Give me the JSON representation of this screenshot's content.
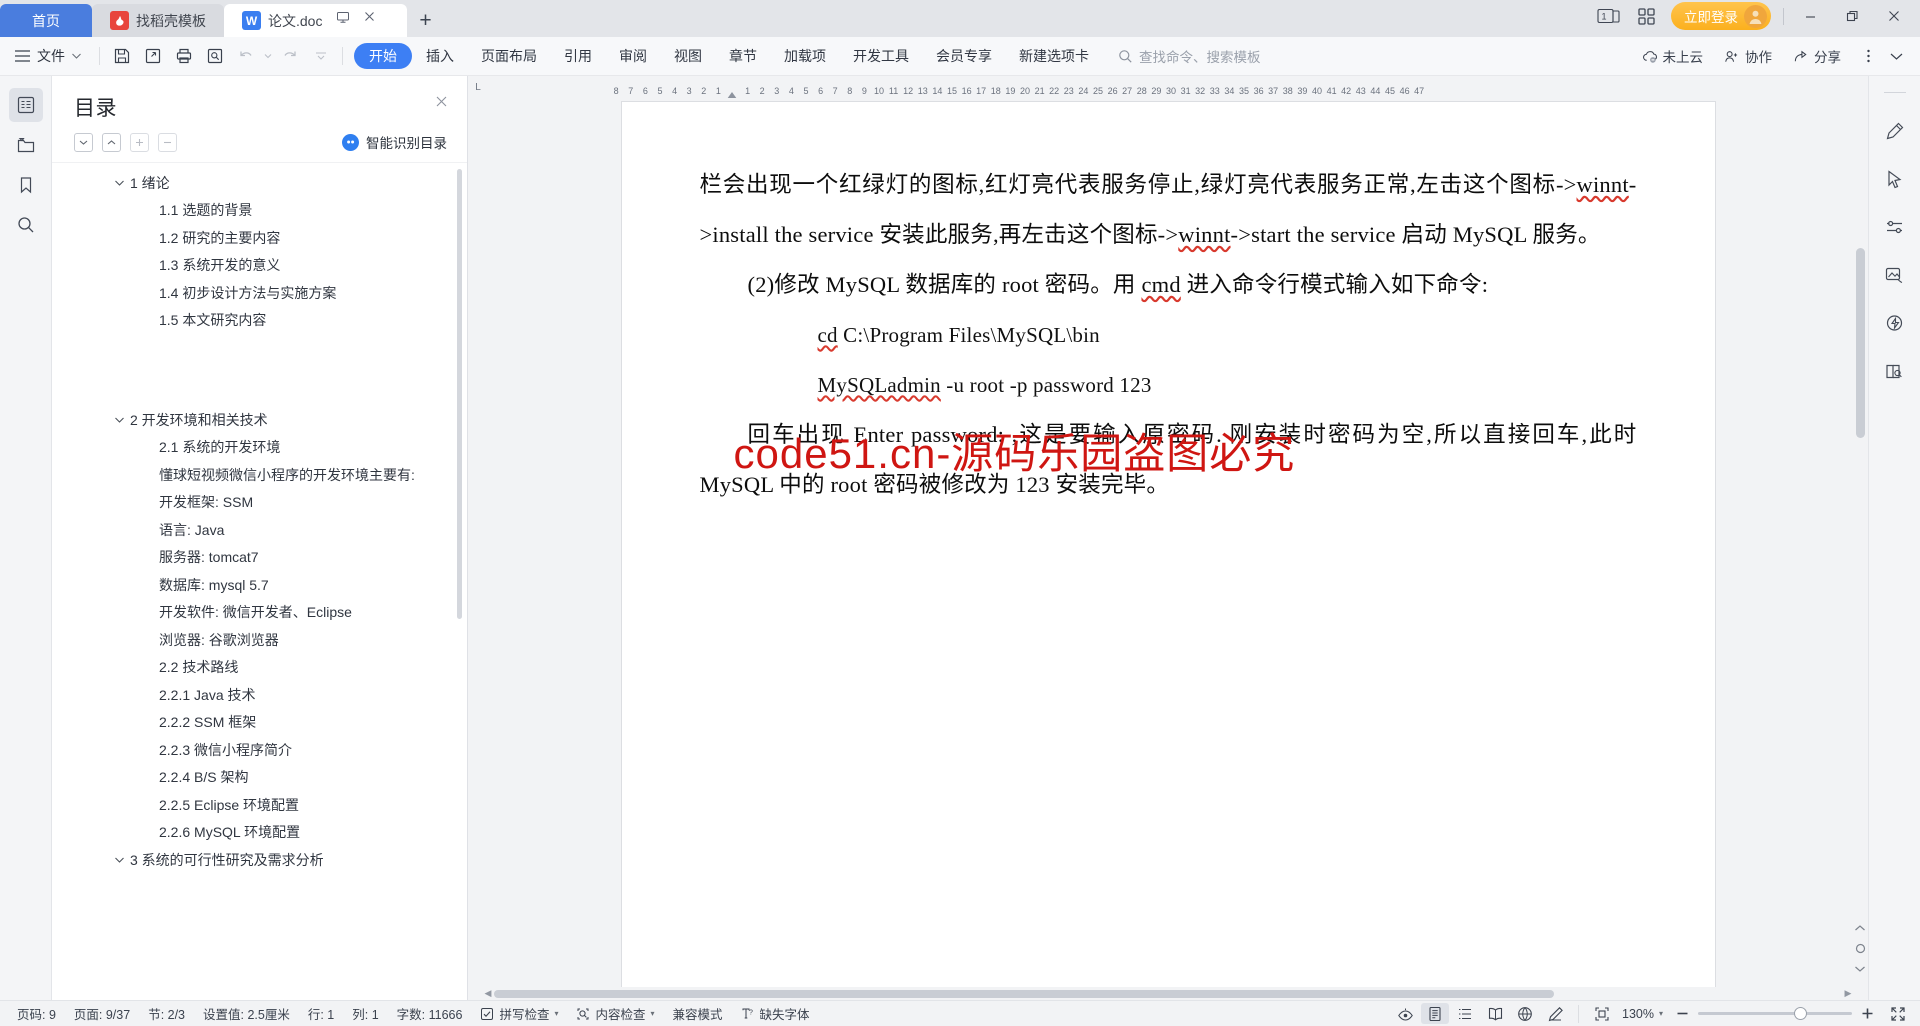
{
  "titlebar": {
    "tabs": [
      {
        "label": "首页",
        "kind": "home"
      },
      {
        "label": "找稻壳模板",
        "kind": "docer"
      },
      {
        "label": "论文.doc",
        "kind": "wps"
      }
    ],
    "new_tab_label": "+",
    "page_count_badge": "1",
    "login_label": "立即登录",
    "window_minimize": "—",
    "window_restore": "❐",
    "window_close": "✕"
  },
  "ribbon": {
    "file_label": "文件",
    "quick_access": [
      "save-icon",
      "save-as-icon",
      "print-icon",
      "print-preview-icon",
      "undo-icon",
      "redo-icon",
      "customize-icon"
    ],
    "tabs": [
      "开始",
      "插入",
      "页面布局",
      "引用",
      "审阅",
      "视图",
      "章节",
      "加载项",
      "开发工具",
      "会员专享",
      "新建选项卡"
    ],
    "active_tab": "开始",
    "search_placeholder": "查找命令、搜索模板",
    "right_items": [
      {
        "label": "未上云",
        "icon": "cloud-off-icon"
      },
      {
        "label": "协作",
        "icon": "collaborate-icon"
      },
      {
        "label": "分享",
        "icon": "share-icon"
      }
    ]
  },
  "left_rail": [
    "outline-icon",
    "folder-icon",
    "bookmark-icon",
    "search-icon"
  ],
  "navpane": {
    "title": "目录",
    "close_label": "✕",
    "tools": [
      "expand-down-icon",
      "collapse-up-icon",
      "plus-icon",
      "minus-icon"
    ],
    "ai_label": "智能识别目录",
    "items": [
      {
        "level": 1,
        "text": "1  绪论",
        "collapsible": true
      },
      {
        "level": 2,
        "text": "1.1  选题的背景"
      },
      {
        "level": 2,
        "text": "1.2  研究的主要内容"
      },
      {
        "level": 2,
        "text": "1.3  系统开发的意义"
      },
      {
        "level": 2,
        "text": "1.4 初步设计方法与实施方案"
      },
      {
        "level": 2,
        "text": "1.5  本文研究内容"
      },
      {
        "level": 0,
        "text": ""
      },
      {
        "level": 1,
        "text": "2  开发环境和相关技术",
        "collapsible": true
      },
      {
        "level": 2,
        "text": "2.1 系统的开发环境"
      },
      {
        "level": 2,
        "text": "懂球短视频微信小程序的开发环境主要有:"
      },
      {
        "level": 2,
        "text": "开发框架: SSM"
      },
      {
        "level": 2,
        "text": "语言: Java"
      },
      {
        "level": 2,
        "text": "服务器: tomcat7"
      },
      {
        "level": 2,
        "text": "数据库: mysql 5.7"
      },
      {
        "level": 2,
        "text": "开发软件: 微信开发者、Eclipse"
      },
      {
        "level": 2,
        "text": "浏览器: 谷歌浏览器"
      },
      {
        "level": 2,
        "text": "2.2 技术路线"
      },
      {
        "level": 2,
        "text": "2.2.1 Java 技术"
      },
      {
        "level": 2,
        "text": "2.2.2 SSM 框架"
      },
      {
        "level": 2,
        "text": "2.2.3 微信小程序简介"
      },
      {
        "level": 2,
        "text": "2.2.4 B/S 架构"
      },
      {
        "level": 2,
        "text": "2.2.5 Eclipse 环境配置"
      },
      {
        "level": 2,
        "text": "2.2.6 MySQL 环境配置"
      },
      {
        "level": 1,
        "text": "3 系统的可行性研究及需求分析",
        "collapsible": true
      }
    ]
  },
  "ruler": {
    "left_ticks": [
      "8",
      "7",
      "6",
      "5",
      "4",
      "3",
      "2",
      "1"
    ],
    "right_ticks": [
      "1",
      "2",
      "3",
      "4",
      "5",
      "6",
      "7",
      "8",
      "9",
      "10",
      "11",
      "12",
      "13",
      "14",
      "15",
      "16",
      "17",
      "18",
      "19",
      "20",
      "21",
      "22",
      "23",
      "24",
      "25",
      "26",
      "27",
      "28",
      "29",
      "30",
      "31",
      "32",
      "33",
      "34",
      "35",
      "36",
      "37",
      "38",
      "39",
      "40",
      "41",
      "42",
      "43",
      "44",
      "45",
      "46",
      "47"
    ]
  },
  "document": {
    "paragraphs": [
      {
        "type": "text",
        "html": "栏会出现一个红绿灯的图标,红灯亮代表服务停止,绿灯亮代表服务正常,左击这个图标-&gt;<span class=\"sq\">winnt</span>-&gt;install the service 安装此服务,再左击这个图标-&gt;<span class=\"sq\">winnt</span>-&gt;start the service 启动 MySQL 服务。"
      },
      {
        "type": "indent",
        "html": "(2)修改 MySQL 数据库的 root 密码。用 <span class=\"sq\">cmd</span> 进入命令行模式输入如下命令:"
      },
      {
        "type": "code",
        "html": "<span class=\"sq\">cd</span> C:\\Program Files\\MySQL\\bin"
      },
      {
        "type": "code",
        "html": "<span class=\"sq\">MySQLadmin</span> -u root -p password 123"
      },
      {
        "type": "indent",
        "html": "回车出现 Enter password: ,这是要输入原密码. 刚安装时密码为空,所以直接回车,此时 MySQL 中的 root 密码被修改为 123 安装完毕。"
      }
    ],
    "watermark": "code51.cn-源码乐园盗图必究"
  },
  "right_rail": [
    "pen-icon",
    "cursor-icon",
    "sliders-icon",
    "image-ai-icon",
    "lightning-ai-icon",
    "book-search-icon"
  ],
  "status": {
    "left_items": [
      {
        "label": "页码: 9"
      },
      {
        "label": "页面: 9/37"
      },
      {
        "label": "节: 2/3"
      },
      {
        "label": "设置值: 2.5厘米"
      },
      {
        "label": "行: 1"
      },
      {
        "label": "列: 1"
      },
      {
        "label": "字数: 11666"
      },
      {
        "label": "拼写检查",
        "icon": "spellcheck-icon",
        "caret": true
      },
      {
        "label": "内容检查",
        "icon": "content-check-icon",
        "caret": true
      },
      {
        "label": "兼容模式"
      },
      {
        "label": "缺失字体",
        "icon": "missing-font-icon"
      }
    ],
    "view_buttons": [
      "focus-eye-icon",
      "page-view-icon",
      "outline-view-icon",
      "read-view-icon",
      "web-view-icon",
      "edit-pen-icon"
    ],
    "active_view": "page-view-icon",
    "fit_icon": "fit-page-icon",
    "zoom_label": "130%",
    "zoom_out": "—",
    "zoom_in": "+",
    "fullscreen_icon": "fullscreen-icon"
  },
  "colors": {
    "accent_blue": "#3d7ff4",
    "login_orange": "#fbb01e",
    "watermark_red": "#cf1612",
    "home_tab_blue": "#4a7dde"
  }
}
